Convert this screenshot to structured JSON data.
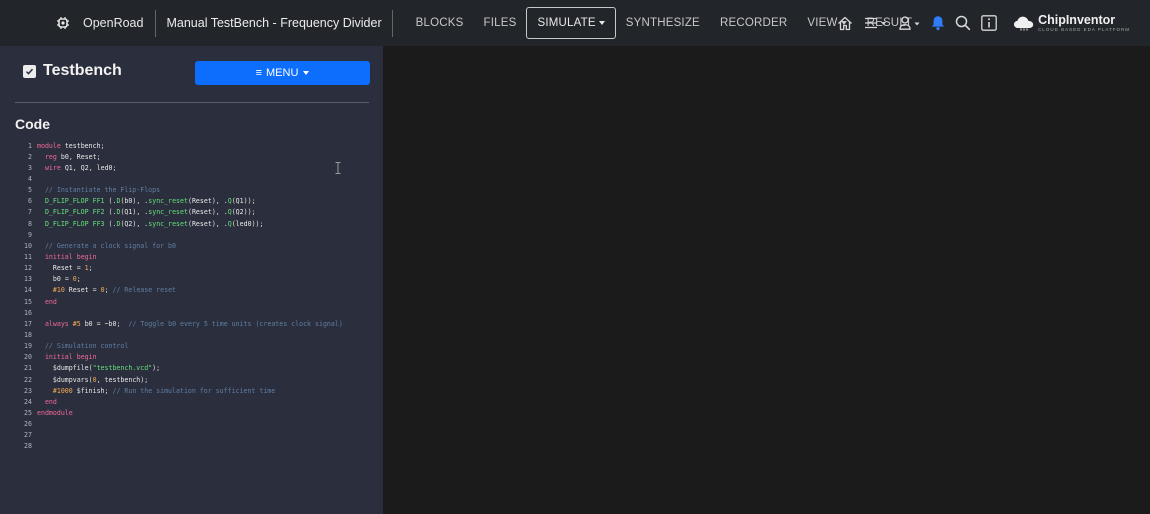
{
  "topbar": {
    "brand": "OpenRoad",
    "project_title": "Manual TestBench - Frequency Divider",
    "nav": [
      {
        "label": "BLOCKS"
      },
      {
        "label": "FILES"
      },
      {
        "label": "SIMULATE",
        "active": true,
        "dropdown": true
      },
      {
        "label": "SYNTHESIZE"
      },
      {
        "label": "RECORDER"
      },
      {
        "label": "VIEW",
        "dropdown": true
      },
      {
        "label": "RESULT"
      }
    ],
    "icons": [
      "home-icon",
      "hamburger-menu-icon",
      "user-icon",
      "bell-icon",
      "search-icon",
      "info-icon"
    ],
    "logo_name": "ChipInventor",
    "logo_tagline": "CLOUD BASED EDA PLATFORM"
  },
  "panel": {
    "title": "Testbench",
    "menu_label": "MENU",
    "code_heading": "Code"
  },
  "code_lines": [
    "module testbench;",
    "  reg b0, Reset;",
    "  wire Q1, Q2, led0;",
    "",
    "  // Instantiate the Flip-Flops",
    "  D_FLIP_FLOP FF1 (.D(b0), .sync_reset(Reset), .Q(Q1));",
    "  D_FLIP_FLOP FF2 (.D(Q1), .sync_reset(Reset), .Q(Q2));",
    "  D_FLIP_FLOP FF3 (.D(Q2), .sync_reset(Reset), .Q(led0));",
    "",
    "  // Generate a clock signal for b0",
    "  initial begin",
    "    Reset = 1;",
    "    b0 = 0;",
    "    #10 Reset = 0; // Release reset",
    "  end",
    "",
    "  always #5 b0 = ~b0;  // Toggle b0 every 5 time units (creates clock signal)",
    "",
    "  // Simulation control",
    "  initial begin",
    "    $dumpfile(\"testbench.vcd\");",
    "    $dumpvars(0, testbench);",
    "    #1000 $finish; // Run the simulation for sufficient time",
    "  end",
    "endmodule",
    "",
    "",
    ""
  ],
  "colors": {
    "accent": "#0d6efd",
    "bell": "#2f7cf6",
    "keyword": "#f06a9b",
    "comment": "#5e7fa5",
    "string": "#64e07a"
  }
}
